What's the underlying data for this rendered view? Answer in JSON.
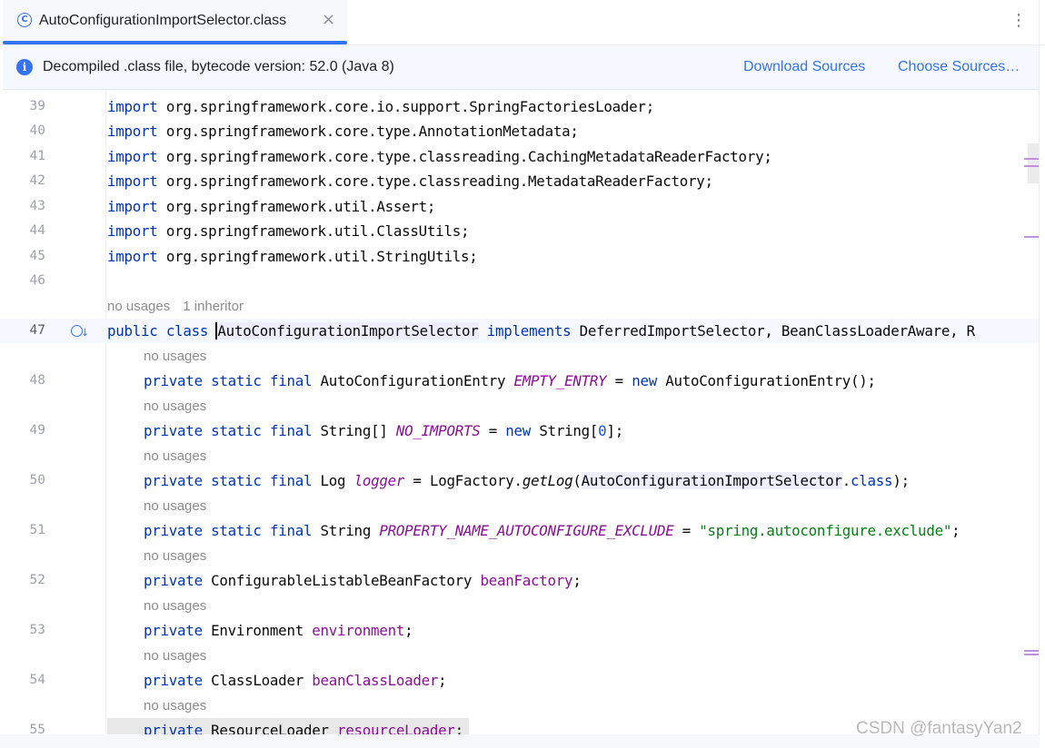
{
  "tab": {
    "icon_letter": "C",
    "title": "AutoConfigurationImportSelector.class",
    "close_glyph": "×"
  },
  "toolbar": {
    "more_glyph": "⋮"
  },
  "banner": {
    "icon_glyph": "i",
    "message": "Decompiled .class file, bytecode version: 52.0 (Java 8)",
    "download_sources": "Download Sources",
    "choose_sources": "Choose Sources…"
  },
  "hints": {
    "no_usages": "no usages",
    "inheritors": "1 inheritor"
  },
  "code": {
    "import_kw": "import",
    "public_kw": "public",
    "class_kw": "class",
    "implements_kw": "implements",
    "private_kw": "private",
    "static_kw": "static",
    "final_kw": "final",
    "new_kw": "new",
    "class_suffix": "class",
    "imports": [
      "org.springframework.core.io.support.SpringFactoriesLoader;",
      "org.springframework.core.type.AnnotationMetadata;",
      "org.springframework.core.type.classreading.CachingMetadataReaderFactory;",
      "org.springframework.core.type.classreading.MetadataReaderFactory;",
      "org.springframework.util.Assert;",
      "org.springframework.util.ClassUtils;",
      "org.springframework.util.StringUtils;"
    ],
    "class_name": "AutoConfigurationImportSelector",
    "interfaces": "DeferredImportSelector, BeanClassLoaderAware, R",
    "entry_type": "AutoConfigurationEntry",
    "empty_entry": "EMPTY_ENTRY",
    "entry_ctor": "AutoConfigurationEntry();",
    "string_arr": "String[]",
    "no_imports": "NO_IMPORTS",
    "string_ctor": "String[",
    "zero": "0",
    "close_arr": "];",
    "log_type": "Log",
    "logger": "logger",
    "log_factory": "LogFactory.",
    "get_log": "getLog",
    "open_paren": "(",
    "close_call": ");",
    "string_type": "String",
    "prop_name": "PROPERTY_NAME_AUTOCONFIGURE_EXCLUDE",
    "prop_value": "\"spring.autoconfigure.exclude\"",
    "semi": ";",
    "bf_type": "ConfigurableListableBeanFactory",
    "bf_name": "beanFactory",
    "env_type": "Environment",
    "env_name": "environment",
    "cl_type": "ClassLoader",
    "cl_name": "beanClassLoader",
    "rl_type": "ResourceLoader",
    "rl_name": "resourceLoader",
    "eq": "=",
    "dot": "."
  },
  "line_numbers": [
    "39",
    "40",
    "41",
    "42",
    "43",
    "44",
    "45",
    "46",
    "47",
    "48",
    "49",
    "50",
    "51",
    "52",
    "53",
    "54",
    "55"
  ],
  "watermark": "CSDN @fantasyYan2",
  "colors": {
    "keyword": "#0033b3",
    "field": "#871094",
    "string": "#067d17",
    "number": "#1750eb",
    "accent": "#3574f0"
  }
}
